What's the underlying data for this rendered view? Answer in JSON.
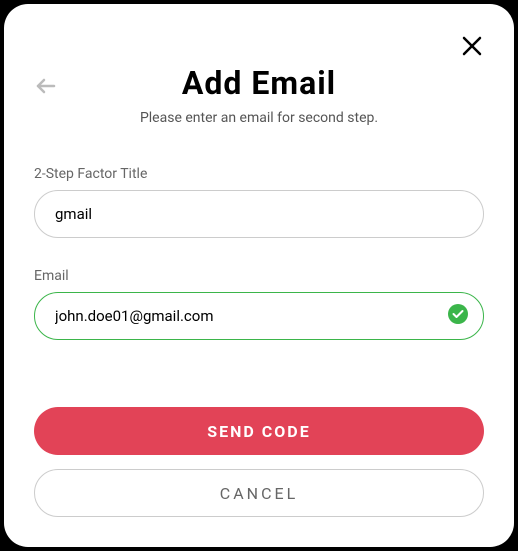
{
  "header": {
    "title": "Add Email",
    "subtitle": "Please enter an email for second step."
  },
  "form": {
    "title_label": "2-Step Factor Title",
    "title_value": "gmail",
    "email_label": "Email",
    "email_value": "john.doe01@gmail.com"
  },
  "buttons": {
    "primary": "SEND CODE",
    "secondary": "CANCEL"
  }
}
